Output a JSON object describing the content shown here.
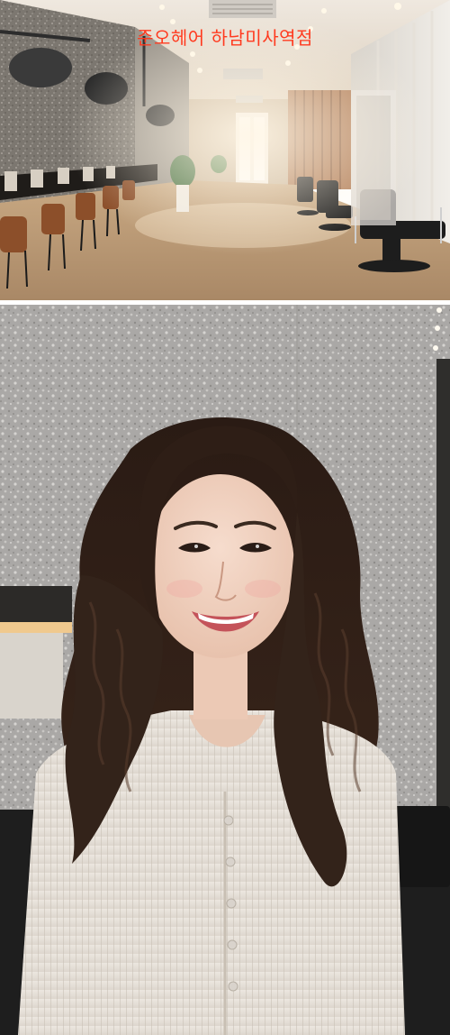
{
  "caption": {
    "text": "준오헤어 하남미사역점",
    "color": "#ff3a1f"
  },
  "photos": [
    {
      "subject": "salon-interior"
    },
    {
      "subject": "portrait"
    }
  ]
}
